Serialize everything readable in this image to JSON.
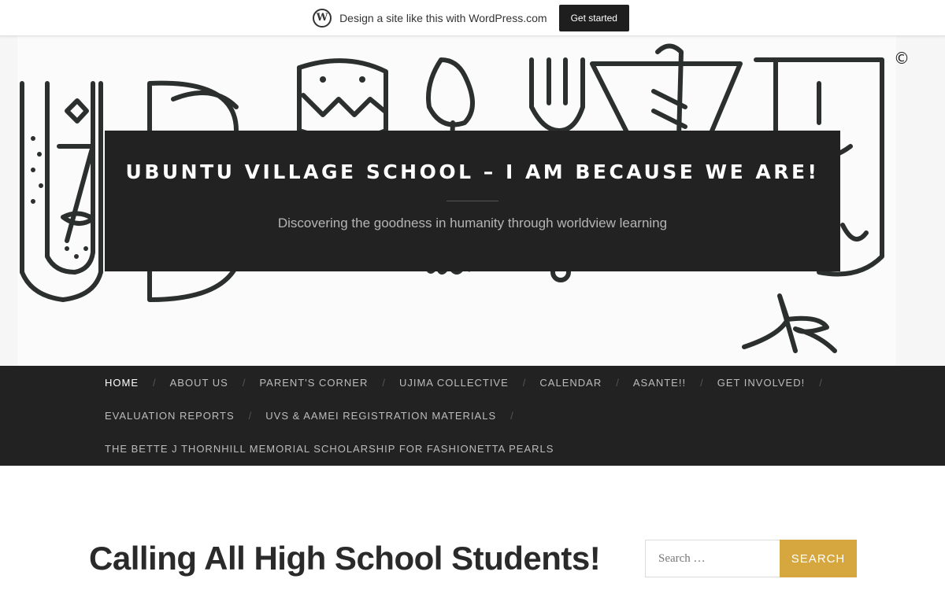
{
  "wp_bar": {
    "logo_glyph": "W",
    "text": "Design a site like this with WordPress.com",
    "button_label": "Get started"
  },
  "header": {
    "copyright_glyph": "©",
    "site_title": "UBUNTU VILLAGE SCHOOL – I AM BECAUSE WE ARE!",
    "site_description": "Discovering the goodness in humanity through worldview learning"
  },
  "nav": {
    "rows": [
      [
        "HOME",
        "ABOUT US",
        "PARENT'S CORNER",
        "UJIMA COLLECTIVE",
        "CALENDAR",
        "ASANTE!!",
        "GET INVOLVED!"
      ],
      [
        "EVALUATION REPORTS",
        "UVS & AAMEI REGISTRATION MATERIALS"
      ],
      [
        "THE BETTE J THORNHILL MEMORIAL SCHOLARSHIP FOR FASHIONETTA PEARLS"
      ]
    ],
    "separator": "/"
  },
  "post": {
    "title": "Calling All High School Students!"
  },
  "search": {
    "placeholder": "Search …",
    "button_label": "Search"
  },
  "colors": {
    "dark": "#222222",
    "accent": "#d6a73f"
  }
}
